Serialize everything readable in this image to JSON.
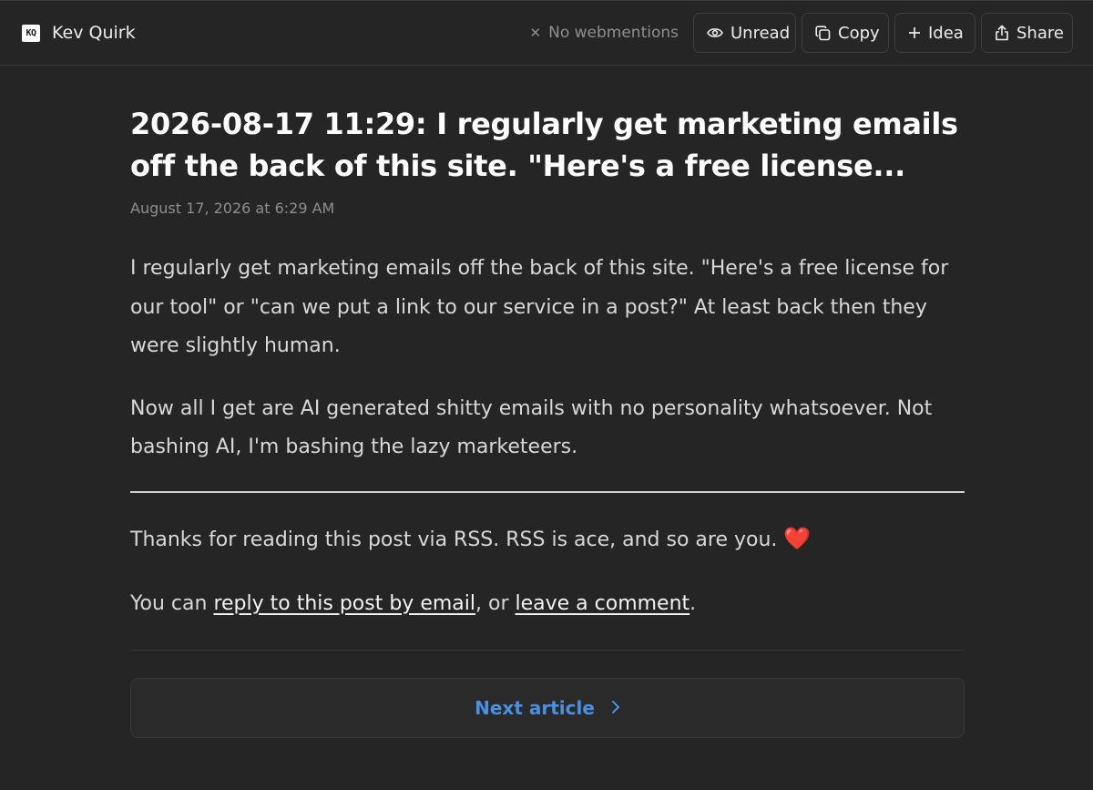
{
  "header": {
    "logo_text": "KQ",
    "site_name": "Kev Quirk",
    "webmentions": "No webmentions",
    "buttons": {
      "unread": "Unread",
      "copy": "Copy",
      "idea": "Idea",
      "share": "Share"
    },
    "icons": {
      "webmentions": "x-icon",
      "unread": "eye-icon",
      "copy": "copy-icon",
      "idea": "plus-icon",
      "share": "share-icon"
    }
  },
  "article": {
    "title": "2026-08-17 11:29: I regularly get marketing emails off the back of this site. \"Here's a free license...",
    "date": "August 17, 2026 at 6:29 AM",
    "paragraphs": [
      "I regularly get marketing emails off the back of this site. \"Here's a free license for our tool\" or \"can we put a link to our service in a post?\" At least back then they were slightly human.",
      "Now all I get are AI generated shitty emails with no personality whatsoever. Not bashing AI, I'm bashing the lazy marketeers."
    ],
    "rss_note": "Thanks for reading this post via RSS. RSS is ace, and so are you.",
    "heart": "❤️",
    "reply_prefix": "You can ",
    "reply_link": "reply to this post by email",
    "reply_middle": ", or ",
    "comment_link": "leave a comment",
    "reply_suffix": "."
  },
  "navigation": {
    "next_label": "Next article"
  },
  "colors": {
    "background": "#252525",
    "accent": "#4a90e2",
    "heart": "#e5303c"
  }
}
